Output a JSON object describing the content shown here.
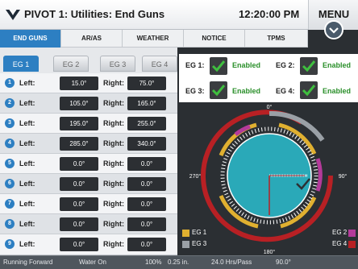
{
  "header": {
    "title": "PIVOT 1: Utilities: End Guns",
    "time": "12:20:00 PM",
    "menu_label": "MENU"
  },
  "top_tabs": [
    {
      "label": "END GUNS",
      "active": true
    },
    {
      "label": "AR/AS",
      "active": false
    },
    {
      "label": "WEATHER",
      "active": false
    },
    {
      "label": "NOTICE",
      "active": false
    },
    {
      "label": "TPMS",
      "active": false
    }
  ],
  "eg_tabs": [
    {
      "label": "EG 1",
      "active": true
    },
    {
      "label": "EG 2",
      "active": false
    },
    {
      "label": "EG 3",
      "active": false
    },
    {
      "label": "EG 4",
      "active": false
    }
  ],
  "rows": [
    {
      "num": "1",
      "left_label": "Left:",
      "right_label": "Right:",
      "left": "15.0°",
      "right": "75.0°"
    },
    {
      "num": "2",
      "left_label": "Left:",
      "right_label": "Right:",
      "left": "105.0°",
      "right": "165.0°"
    },
    {
      "num": "3",
      "left_label": "Left:",
      "right_label": "Right:",
      "left": "195.0°",
      "right": "255.0°"
    },
    {
      "num": "4",
      "left_label": "Left:",
      "right_label": "Right:",
      "left": "285.0°",
      "right": "340.0°"
    },
    {
      "num": "5",
      "left_label": "Left:",
      "right_label": "Right:",
      "left": "0.0°",
      "right": "0.0°"
    },
    {
      "num": "6",
      "left_label": "Left:",
      "right_label": "Right:",
      "left": "0.0°",
      "right": "0.0°"
    },
    {
      "num": "7",
      "left_label": "Left:",
      "right_label": "Right:",
      "left": "0.0°",
      "right": "0.0°"
    },
    {
      "num": "8",
      "left_label": "Left:",
      "right_label": "Right:",
      "left": "0.0°",
      "right": "0.0°"
    },
    {
      "num": "9",
      "left_label": "Left:",
      "right_label": "Right:",
      "left": "0.0°",
      "right": "0.0°"
    }
  ],
  "status": [
    {
      "label": "EG 1:",
      "value": "Enabled"
    },
    {
      "label": "EG 2:",
      "value": "Enabled"
    },
    {
      "label": "EG 3:",
      "value": "Enabled"
    },
    {
      "label": "EG 4:",
      "value": "Enabled"
    }
  ],
  "gauge": {
    "deg_0": "0°",
    "deg_90": "90°",
    "deg_180": "180°",
    "deg_270": "270°",
    "pivot_position_deg": 90
  },
  "legend": [
    {
      "label": "EG 1",
      "color": "#e0b030"
    },
    {
      "label": "EG 2",
      "color": "#b43a9a"
    },
    {
      "label": "EG 3",
      "color": "#9aa0a6"
    },
    {
      "label": "EG 4",
      "color": "#b82024"
    }
  ],
  "footer": {
    "direction": "Running Forward",
    "water": "Water On",
    "speed": "100%",
    "depth": "0.25 in.",
    "pass_time": "24.0 Hrs/Pass",
    "angle": "90.0°"
  },
  "colors": {
    "accent": "#2d7fc2",
    "enabled_green": "#2a8f2a",
    "gauge_face": "#2aa9b8"
  }
}
